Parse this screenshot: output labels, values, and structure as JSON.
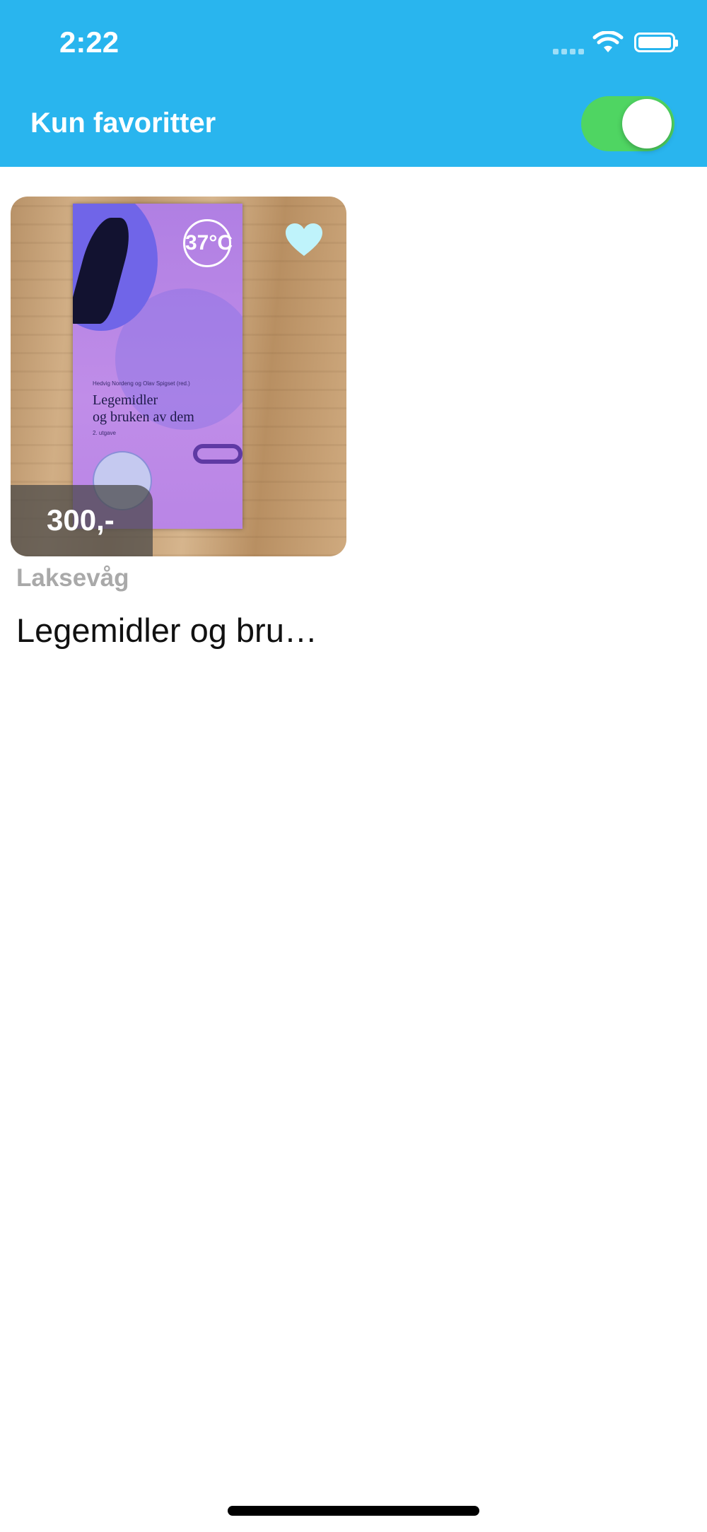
{
  "status_bar": {
    "time": "2:22",
    "icons": [
      "signal-dots-icon",
      "wifi-icon",
      "battery-icon"
    ]
  },
  "nav": {
    "title": "Kun favoritter",
    "favorites_toggle_on": true
  },
  "listings": [
    {
      "price": "300,-",
      "location": "Laksevåg",
      "title": "Legemidler og bru…",
      "favorited": true,
      "image": {
        "description_icon": "book-cover-image",
        "cover_badge": "37°C",
        "cover_authors": "Hedvig Nordeng og Olav Spigset (red.)",
        "cover_title_line1": "Legemidler",
        "cover_title_line2": "og bruken av dem",
        "cover_edition": "2. utgave"
      }
    }
  ],
  "colors": {
    "header": "#29b5ee",
    "toggle_on": "#4fd562",
    "heart": "#bff3fb",
    "location_text": "#a9a9a9"
  }
}
